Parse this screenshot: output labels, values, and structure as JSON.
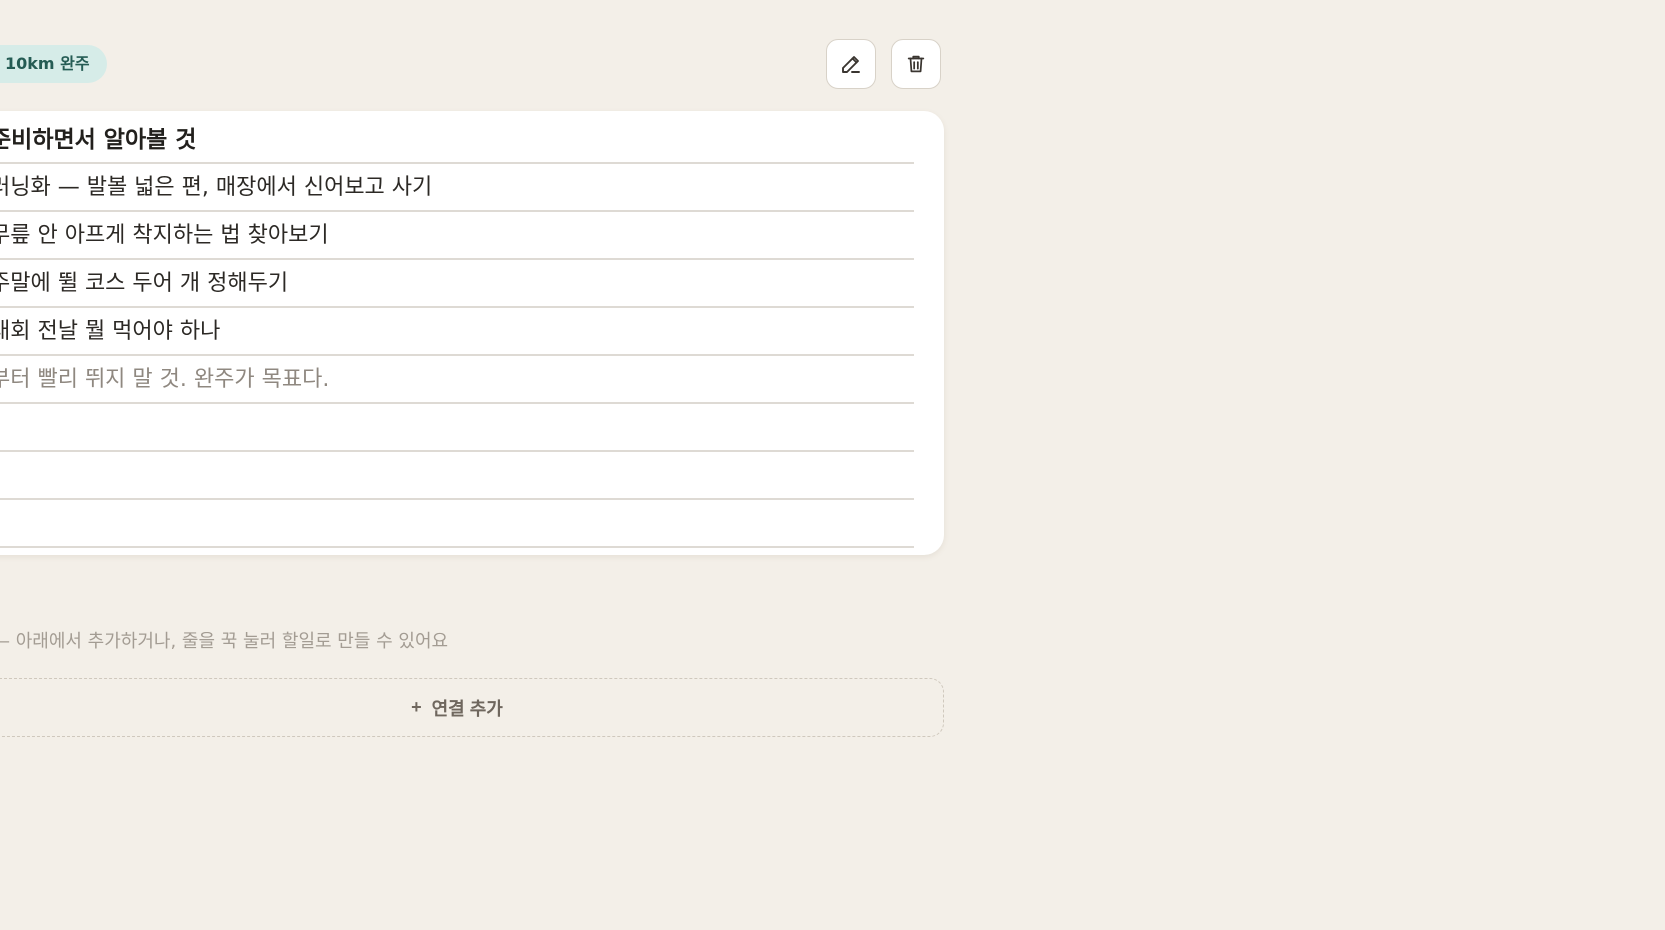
{
  "tag": {
    "label": "10km 완주"
  },
  "toolbar": {
    "edit_icon": "pencil-icon",
    "delete_icon": "trash-icon"
  },
  "note": {
    "heading": "준비하면서 알아볼 것",
    "lines": [
      "러닝화 — 발볼 넓은 편, 매장에서 신어보고 사기",
      "무릎 안 아프게 착지하는 법 찾아보기",
      "주말에 뛸 코스 두어 개 정해두기",
      "대회 전날 뭘 먹어야 하나",
      "부터 빨리 뛰지 말 것. 완주가 목표다.",
      "",
      "",
      ""
    ]
  },
  "links": {
    "helper_text": "— 아래에서 추가하거나, 줄을 꾹 눌러 할일로 만들 수 있어요",
    "add_plus": "+",
    "add_label": "연결 추가"
  },
  "colors": {
    "background": "#f3efe8",
    "tag_background": "#d6ece8",
    "tag_text": "#255c54",
    "card": "#ffffff",
    "rule": "#dedad4",
    "muted_text": "#a39c93"
  }
}
